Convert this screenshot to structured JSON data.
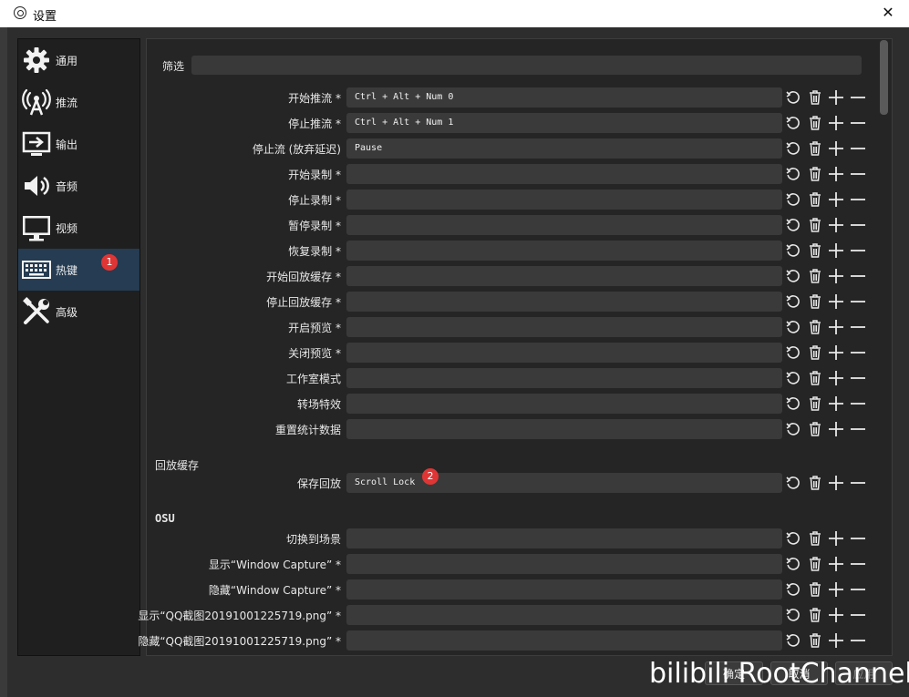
{
  "window": {
    "title": "设置",
    "close_glyph": "✕"
  },
  "sidebar": {
    "items": [
      {
        "label": "通用",
        "icon": "gear-icon"
      },
      {
        "label": "推流",
        "icon": "antenna-icon"
      },
      {
        "label": "输出",
        "icon": "output-icon"
      },
      {
        "label": "音频",
        "icon": "speaker-icon"
      },
      {
        "label": "视频",
        "icon": "monitor-icon"
      },
      {
        "label": "热键",
        "icon": "keyboard-icon",
        "active": true,
        "badge": "1"
      },
      {
        "label": "高级",
        "icon": "tools-icon"
      }
    ]
  },
  "filter": {
    "label": "筛选",
    "value": ""
  },
  "hotkeys": [
    {
      "label": "开始推流 *",
      "value": "Ctrl + Alt + Num 0"
    },
    {
      "label": "停止推流 *",
      "value": "Ctrl + Alt + Num 1"
    },
    {
      "label": "停止流 (放弃延迟)",
      "value": "Pause"
    },
    {
      "label": "开始录制 *",
      "value": ""
    },
    {
      "label": "停止录制 *",
      "value": ""
    },
    {
      "label": "暂停录制 *",
      "value": ""
    },
    {
      "label": "恢复录制 *",
      "value": ""
    },
    {
      "label": "开始回放缓存 *",
      "value": ""
    },
    {
      "label": "停止回放缓存 *",
      "value": ""
    },
    {
      "label": "开启预览 *",
      "value": ""
    },
    {
      "label": "关闭预览 *",
      "value": ""
    },
    {
      "label": "工作室模式",
      "value": ""
    },
    {
      "label": "转场特效",
      "value": ""
    },
    {
      "label": "重置统计数据",
      "value": ""
    }
  ],
  "replay_section": {
    "title": "回放缓存",
    "rows": [
      {
        "label": "保存回放",
        "value": "Scroll Lock",
        "badge": "2"
      }
    ]
  },
  "osu_section": {
    "title": "OSU",
    "rows": [
      {
        "label": "切换到场景",
        "value": ""
      },
      {
        "label": "显示“Window Capture” *",
        "value": ""
      },
      {
        "label": "隐藏“Window Capture” *",
        "value": ""
      },
      {
        "label": "显示“QQ截图20191001225719.png” *",
        "value": ""
      },
      {
        "label": "隐藏“QQ截图20191001225719.png” *",
        "value": ""
      }
    ]
  },
  "footer": {
    "ok": "确定",
    "cancel": "取消",
    "apply": "应用"
  },
  "watermark": "bilibili RootChannel",
  "colors": {
    "active_nav": "#253c52",
    "badge": "#e03535"
  }
}
